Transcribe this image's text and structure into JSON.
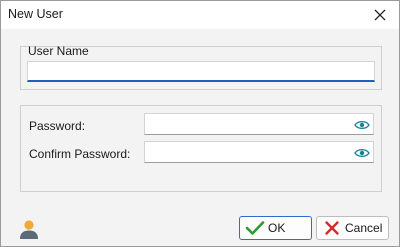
{
  "window": {
    "title": "New User"
  },
  "form": {
    "username": {
      "label": "User Name",
      "value": ""
    },
    "password": {
      "label": "Password:",
      "value": ""
    },
    "confirm_password": {
      "label": "Confirm Password:",
      "value": ""
    }
  },
  "buttons": {
    "ok": "OK",
    "cancel": "Cancel"
  },
  "icons": {
    "close": "close-icon",
    "eye": "eye-icon",
    "ok": "checkmark-icon",
    "cancel": "x-mark-icon",
    "user": "user-icon"
  },
  "colors": {
    "accent": "#1f5fbf",
    "ok_check": "#2e9d2e",
    "cancel_x": "#d6292c",
    "eye": "#1a7f96",
    "avatar_head": "#f2a93b",
    "avatar_body": "#5b6b7a"
  }
}
